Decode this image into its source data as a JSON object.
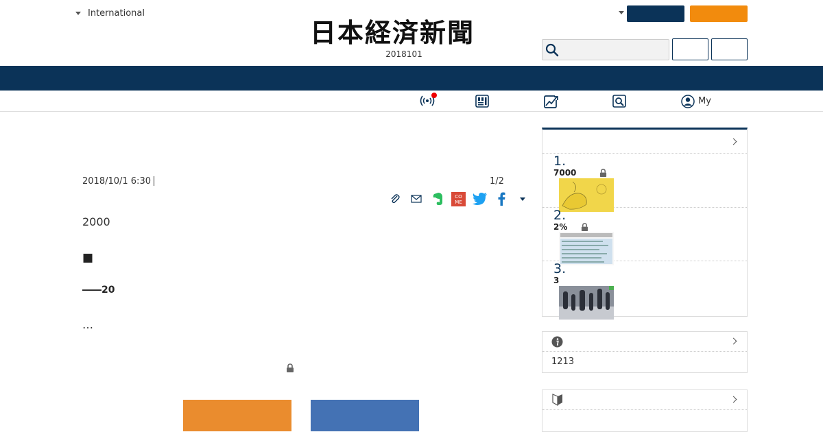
{
  "header": {
    "region_label": "International",
    "logo_text": "日本経済新聞",
    "edition_date": "2018101",
    "my_label": "My"
  },
  "article": {
    "datetime": "2018/10/1 6:30",
    "page_indicator": "1/2",
    "paragraphs": [
      "2000",
      "■",
      "――20",
      "…"
    ]
  },
  "sidebar": {
    "ranking": [
      {
        "rank": "1.",
        "title": "7000",
        "locked": true
      },
      {
        "rank": "2.",
        "title": "2%",
        "locked": true
      },
      {
        "rank": "3.",
        "title": "3",
        "locked": false
      }
    ],
    "info_text": "1213"
  },
  "colors": {
    "navy": "#0b3358",
    "orange": "#f28b0d",
    "cta_orange": "#ea8c2e",
    "cta_blue": "#4472b4",
    "live_dot": "#e00000"
  }
}
